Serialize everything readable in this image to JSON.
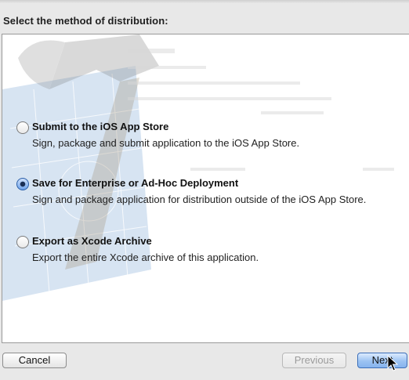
{
  "dialog": {
    "heading": "Select the method of distribution:"
  },
  "options": [
    {
      "title": "Submit to the iOS App Store",
      "description": "Sign, package and submit application to the iOS App Store.",
      "selected": false
    },
    {
      "title": "Save for Enterprise or Ad-Hoc Deployment",
      "description": "Sign and package application for distribution outside of the iOS App Store.",
      "selected": true
    },
    {
      "title": "Export as Xcode Archive",
      "description": "Export the entire Xcode archive of this application.",
      "selected": false
    }
  ],
  "buttons": {
    "cancel": "Cancel",
    "previous": "Previous",
    "next": "Next"
  },
  "colors": {
    "selected_radio": "#6ea2ea",
    "default_button": "#9cc3f2"
  }
}
